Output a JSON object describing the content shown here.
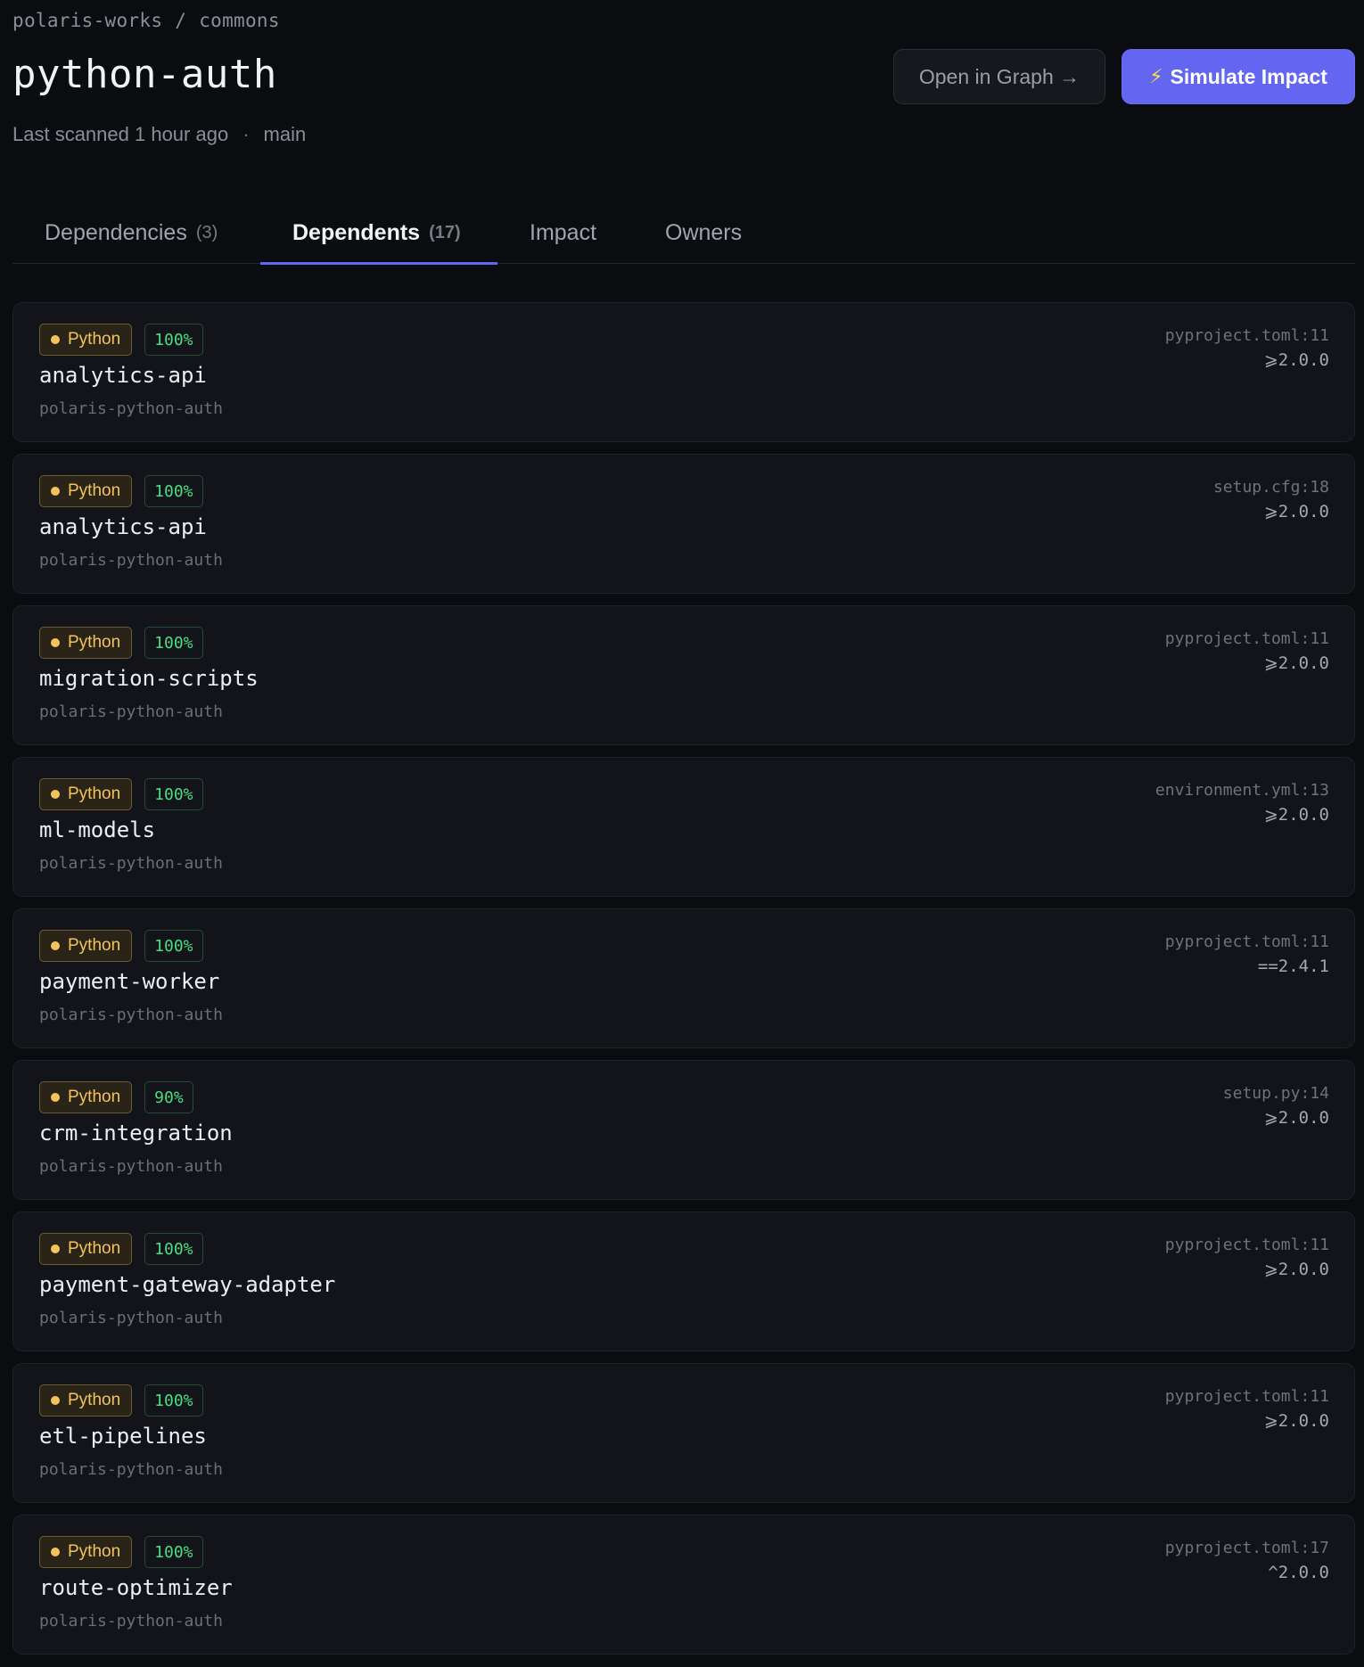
{
  "breadcrumb": {
    "org": "polaris-works",
    "separator": "/",
    "repo": "commons"
  },
  "page": {
    "title": "python-auth",
    "last_scanned": "Last scanned 1 hour ago",
    "meta_separator": "·",
    "branch": "main"
  },
  "actions": {
    "open_graph_label": "Open in Graph →",
    "simulate_icon": "⚡",
    "simulate_label": "Simulate Impact"
  },
  "tabs": [
    {
      "label": "Dependencies",
      "count": "(3)",
      "active": false
    },
    {
      "label": "Dependents",
      "count": "(17)",
      "active": true
    },
    {
      "label": "Impact",
      "count": "",
      "active": false
    },
    {
      "label": "Owners",
      "count": "",
      "active": false
    }
  ],
  "colors": {
    "accent": "#6366f1",
    "python_badge": "#f2c45a",
    "score_green": "#4ade80"
  },
  "dependents": [
    {
      "language": "Python",
      "score": "100%",
      "name": "analytics-api",
      "package": "polaris-python-auth",
      "source": "pyproject.toml:11",
      "version": "⩾2.0.0"
    },
    {
      "language": "Python",
      "score": "100%",
      "name": "analytics-api",
      "package": "polaris-python-auth",
      "source": "setup.cfg:18",
      "version": "⩾2.0.0"
    },
    {
      "language": "Python",
      "score": "100%",
      "name": "migration-scripts",
      "package": "polaris-python-auth",
      "source": "pyproject.toml:11",
      "version": "⩾2.0.0"
    },
    {
      "language": "Python",
      "score": "100%",
      "name": "ml-models",
      "package": "polaris-python-auth",
      "source": "environment.yml:13",
      "version": "⩾2.0.0"
    },
    {
      "language": "Python",
      "score": "100%",
      "name": "payment-worker",
      "package": "polaris-python-auth",
      "source": "pyproject.toml:11",
      "version": "==2.4.1"
    },
    {
      "language": "Python",
      "score": "90%",
      "name": "crm-integration",
      "package": "polaris-python-auth",
      "source": "setup.py:14",
      "version": "⩾2.0.0"
    },
    {
      "language": "Python",
      "score": "100%",
      "name": "payment-gateway-adapter",
      "package": "polaris-python-auth",
      "source": "pyproject.toml:11",
      "version": "⩾2.0.0"
    },
    {
      "language": "Python",
      "score": "100%",
      "name": "etl-pipelines",
      "package": "polaris-python-auth",
      "source": "pyproject.toml:11",
      "version": "⩾2.0.0"
    },
    {
      "language": "Python",
      "score": "100%",
      "name": "route-optimizer",
      "package": "polaris-python-auth",
      "source": "pyproject.toml:17",
      "version": "^2.0.0"
    }
  ]
}
